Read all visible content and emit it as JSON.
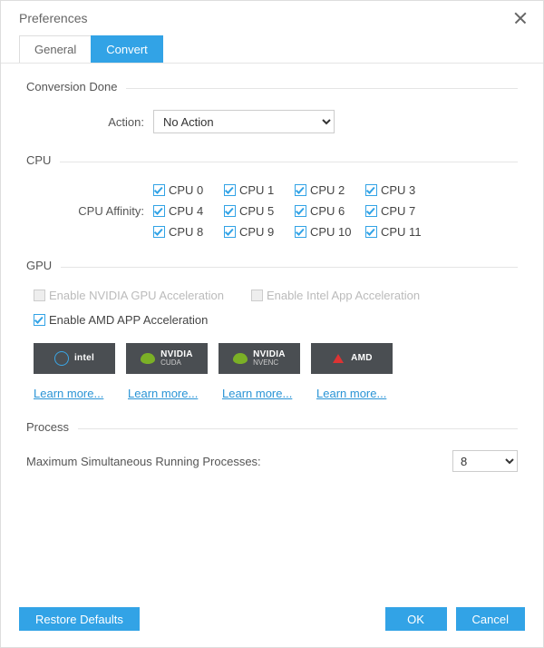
{
  "title": "Preferences",
  "tabs": {
    "general": "General",
    "convert": "Convert",
    "active": "convert"
  },
  "conversion_done": {
    "section": "Conversion Done",
    "action_label": "Action:",
    "action_value": "No Action"
  },
  "cpu": {
    "section": "CPU",
    "affinity_label": "CPU Affinity:",
    "items": [
      "CPU 0",
      "CPU 1",
      "CPU 2",
      "CPU 3",
      "CPU 4",
      "CPU 5",
      "CPU 6",
      "CPU 7",
      "CPU 8",
      "CPU 9",
      "CPU 10",
      "CPU 11"
    ]
  },
  "gpu": {
    "section": "GPU",
    "nvidia_label": "Enable NVIDIA GPU Acceleration",
    "intel_label": "Enable Intel App Acceleration",
    "amd_label": "Enable AMD APP Acceleration",
    "badges": {
      "intel": "intel",
      "nvidia_top": "NVIDIA",
      "cuda": "CUDA",
      "nvenc": "NVENC",
      "amd": "AMD"
    },
    "learn_more": "Learn more..."
  },
  "process": {
    "section": "Process",
    "label": "Maximum Simultaneous Running Processes:",
    "value": "8"
  },
  "footer": {
    "restore": "Restore Defaults",
    "ok": "OK",
    "cancel": "Cancel"
  }
}
